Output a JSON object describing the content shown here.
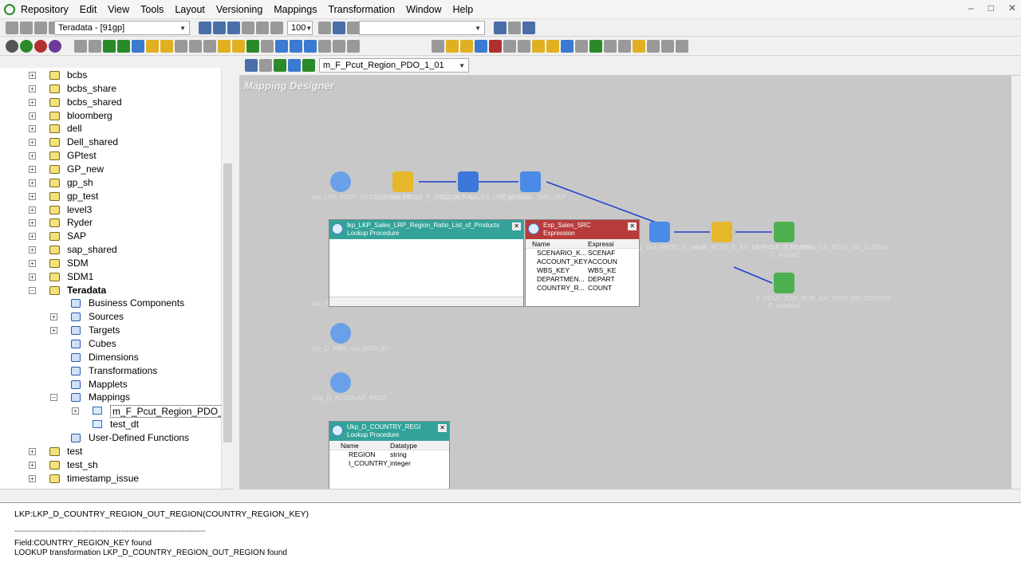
{
  "menu": [
    "Repository",
    "Edit",
    "View",
    "Tools",
    "Layout",
    "Versioning",
    "Mappings",
    "Transformation",
    "Window",
    "Help"
  ],
  "toolbar": {
    "folder_combo": "Teradata - [91gp]",
    "zoom_combo": "100",
    "mapping_combo": "m_F_Pcut_Region_PDO_1_01"
  },
  "tree": {
    "folders": [
      "bcbs",
      "bcbs_share",
      "bcbs_shared",
      "bloomberg",
      "dell",
      "Dell_shared",
      "GPtest",
      "GP_new",
      "gp_sh",
      "gp_test",
      "level3",
      "Ryder",
      "SAP",
      "sap_shared",
      "SDM",
      "SDM1"
    ],
    "open_folder": "Teradata",
    "sub": [
      "Business Components",
      "Sources",
      "Targets",
      "Cubes",
      "Dimensions",
      "Transformations",
      "Mapplets",
      "Mappings"
    ],
    "mappings": [
      "m_F_Pcut_Region_PDO_1_01",
      "test_dt"
    ],
    "udf": "User-Defined Functions",
    "after": [
      "test",
      "test_sh",
      "timestamp_issue"
    ]
  },
  "canvas": {
    "title": "Mapping Designer",
    "nodes": [
      {
        "label": "lkp_LKP_PCUT_CODE_DMaa_PRO..."
      },
      {
        "label": "LKP_SALES_LR_P_REGION_RA..."
      },
      {
        "label": "SQ_LKP_SALES_LRP_REGIO..."
      },
      {
        "label": "Exp_Sales_SRC_LKP"
      },
      {
        "label": "lkp_D_WBS_out_WBS_ID"
      },
      {
        "label": "Lkp_D_ACCOUNT_PCUT"
      },
      {
        "label": "Exp_Get_PROD_T_NAME"
      },
      {
        "label": "rtr_F_PCUT_E_KP_NON_GA_R_EGION"
      },
      {
        "label": "F_PCUT_EXP_NON_GA_REGI_ON_GLOBAL (T_eradat)"
      },
      {
        "label": "F_PCUT_EXP_NON_GA_REGI_ON_OTHERS (T_eradata)"
      },
      {
        "label": "lkp_Region_out_key"
      }
    ],
    "lookup_window": {
      "title": "lkp_LKP_Sales_LRP_Region_Ratio_List_of_Products",
      "subtitle": "Lookup Procedure"
    },
    "expression_window": {
      "title": "Exp_Sales_SRC",
      "subtitle": "Expression",
      "cols": [
        "Name",
        "Expressi"
      ],
      "rows": [
        [
          "SCENARIO_K...",
          "SCENAF"
        ],
        [
          "ACCOUNT_KEY",
          "ACCOUN"
        ],
        [
          "WBS_KEY",
          "WBS_KE"
        ],
        [
          "DEPARTMEN...",
          "DEPART"
        ],
        [
          "COUNTRY_R...",
          "COUNT"
        ]
      ]
    },
    "country_window": {
      "title": "Ukp_D_COUNTRY_REGI",
      "subtitle": "Lookup Procedure",
      "cols": [
        "Name",
        "Datatype"
      ],
      "rows": [
        [
          "REGION",
          "string"
        ],
        [
          "I_COUNTRY_...",
          "integer"
        ]
      ]
    }
  },
  "output": {
    "lines": [
      "LKP:LKP_D_COUNTRY_REGION_OUT_REGION(COUNTRY_REGION_KEY)",
      "------------------------------------------------------------------------",
      "Field:COUNTRY_REGION_KEY found",
      "LOOKUP transformation  LKP_D_COUNTRY_REGION_OUT_REGION found"
    ]
  },
  "colors": {
    "accent": "#1f5ab8",
    "lookup_header": "#33a39a",
    "expression_header": "#b83b3b"
  }
}
